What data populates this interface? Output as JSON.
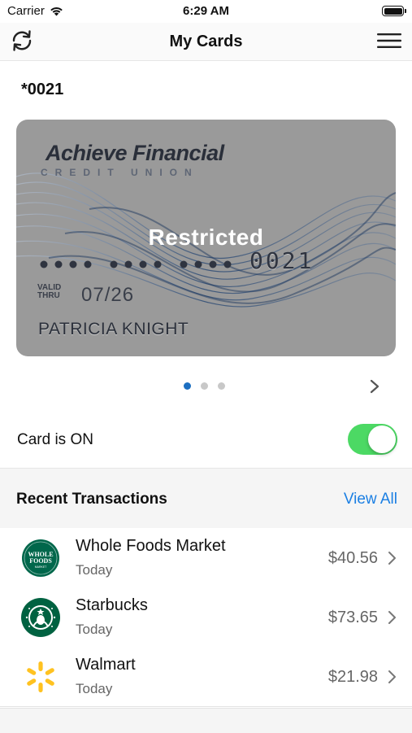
{
  "status_bar": {
    "carrier": "Carrier",
    "time": "6:29 AM"
  },
  "nav": {
    "title": "My Cards",
    "left_icon": "refresh-icon",
    "right_icon": "hamburger-menu-icon"
  },
  "card": {
    "masked_number": "*0021",
    "brand": "Achieve Financial",
    "brand_subtitle": "CREDIT UNION",
    "overlay_status": "Restricted",
    "pan_last4": "0021",
    "valid_thru_label": "VALID THRU",
    "expiry": "07/26",
    "holder": "PATRICIA KNIGHT"
  },
  "carousel": {
    "page_count": 3,
    "active_index": 0,
    "next_icon": "chevron-right-icon"
  },
  "card_status": {
    "label": "Card is ON",
    "enabled": true,
    "on_color": "#4cd964"
  },
  "transactions": {
    "header": "Recent Transactions",
    "view_all": "View All",
    "items": [
      {
        "merchant": "Whole Foods Market",
        "date": "Today",
        "amount": "$40.56",
        "logo_text": "WHOLE FOODS",
        "logo_sub": "MARKET",
        "icon": "whole-foods-logo-icon"
      },
      {
        "merchant": "Starbucks",
        "date": "Today",
        "amount": "$73.65",
        "icon": "starbucks-logo-icon"
      },
      {
        "merchant": "Walmart",
        "date": "Today",
        "amount": "$21.98",
        "icon": "walmart-spark-icon"
      }
    ]
  },
  "colors": {
    "accent": "#1b7fe3",
    "pager_active": "#1c6fc1",
    "whole_foods_green": "#00674b",
    "starbucks_green": "#006241",
    "walmart_yellow": "#ffc220"
  }
}
